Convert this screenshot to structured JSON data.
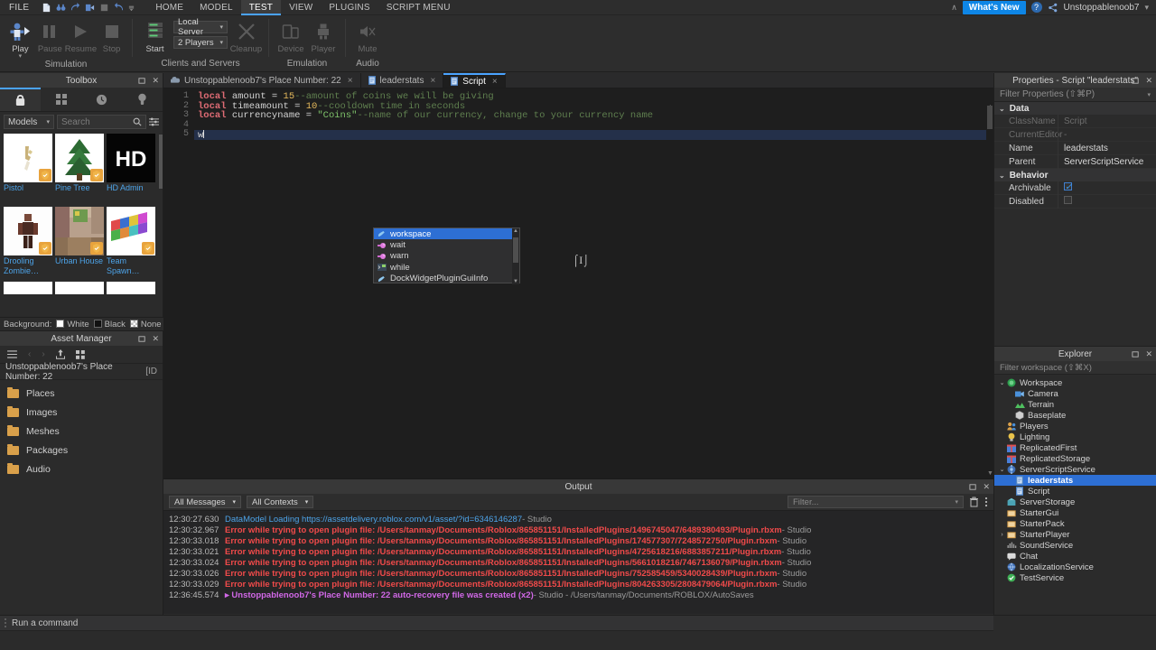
{
  "menubar": {
    "file_label": "FILE",
    "quick_icons": [
      "new-file-icon",
      "binoculars-icon",
      "redo-icon",
      "publish-icon",
      "stop-icon",
      "undo-icon",
      "overflow-icon"
    ],
    "tabs": [
      {
        "label": "HOME",
        "active": false
      },
      {
        "label": "MODEL",
        "active": false
      },
      {
        "label": "TEST",
        "active": true
      },
      {
        "label": "VIEW",
        "active": false
      },
      {
        "label": "PLUGINS",
        "active": false
      },
      {
        "label": "SCRIPT MENU",
        "active": false
      }
    ],
    "whats_new": "What's New",
    "help_icon": "?",
    "share_icon": "share-icon",
    "user": "Unstoppablenoob7",
    "user_caret": "▾",
    "collapse_caret": "∧",
    "accent_color": "#0e86e6"
  },
  "ribbon": {
    "groups": [
      {
        "label": "Simulation",
        "buttons": [
          {
            "label": "Play",
            "icon": "play-avatar-icon",
            "enabled": true,
            "has_caret": true
          },
          {
            "label": "Pause",
            "icon": "pause-icon",
            "enabled": false
          },
          {
            "label": "Resume",
            "icon": "resume-icon",
            "enabled": false
          },
          {
            "label": "Stop",
            "icon": "stop-icon",
            "enabled": false
          }
        ]
      },
      {
        "label": "Clients and Servers",
        "buttons": [
          {
            "label": "Start",
            "icon": "server-rack-icon",
            "enabled": true
          },
          {
            "label": "Cleanup",
            "icon": "cleanup-x-icon",
            "enabled": false
          }
        ],
        "combos": [
          {
            "value": "Local Server",
            "caret": "▾"
          },
          {
            "value": "2 Players",
            "caret": "▾"
          }
        ]
      },
      {
        "label": "Emulation",
        "buttons": [
          {
            "label": "Device",
            "icon": "device-icon",
            "enabled": false
          },
          {
            "label": "Player",
            "icon": "player-icon",
            "enabled": false
          }
        ]
      },
      {
        "label": "Audio",
        "buttons": [
          {
            "label": "Mute",
            "icon": "mute-speaker-icon",
            "enabled": false
          }
        ]
      }
    ]
  },
  "toolbox": {
    "title": "Toolbox",
    "tabs": [
      {
        "icon": "backpack-icon",
        "active": true
      },
      {
        "icon": "grid-icon",
        "active": false
      },
      {
        "icon": "clock-icon",
        "active": false
      },
      {
        "icon": "bulb-icon",
        "active": false
      }
    ],
    "category": "Models",
    "category_caret": "▾",
    "search_placeholder": "Search",
    "search_icon": "search-icon",
    "filter_icon": "filter-sliders-icon",
    "items": [
      {
        "name": "Pistol",
        "thumb": "pistol"
      },
      {
        "name": "Pine Tree",
        "thumb": "pinetree"
      },
      {
        "name": "HD Admin",
        "thumb": "hdadmin"
      },
      {
        "name": "Drooling Zombie…",
        "thumb": "zombie"
      },
      {
        "name": "Urban House",
        "thumb": "house"
      },
      {
        "name": "Team Spawn…",
        "thumb": "spawn"
      }
    ],
    "background_label": "Background:",
    "background_options": [
      {
        "label": "White",
        "selected": true
      },
      {
        "label": "Black",
        "selected": false
      },
      {
        "label": "None",
        "selected": false
      }
    ]
  },
  "asset_manager": {
    "title": "Asset Manager",
    "toolbar_icons": [
      "hamburger-icon",
      "back-arrow-icon",
      "forward-arrow-icon",
      "upload-icon",
      "grid-view-icon"
    ],
    "path": "Unstoppablenoob7's Place Number: 22",
    "path_suffix": "[ID",
    "folders": [
      "Places",
      "Images",
      "Meshes",
      "Packages",
      "Audio"
    ]
  },
  "editor": {
    "tabs": [
      {
        "label": "Unstoppablenoob7's Place Number: 22",
        "icon": "place-icon",
        "active": false
      },
      {
        "label": "leaderstats",
        "icon": "script-icon",
        "active": false
      },
      {
        "label": "Script",
        "icon": "script-icon",
        "active": true
      }
    ],
    "close_glyph": "×",
    "line_numbers": [
      "1",
      "2",
      "3",
      "4",
      "5"
    ],
    "lines": [
      [
        {
          "t": "local",
          "c": "kw"
        },
        {
          "t": " amount = ",
          "c": "id"
        },
        {
          "t": "15",
          "c": "num"
        },
        {
          "t": "--amount of coins we will be giving",
          "c": "cmt"
        }
      ],
      [
        {
          "t": "local",
          "c": "kw"
        },
        {
          "t": " timeamount = ",
          "c": "id"
        },
        {
          "t": "10",
          "c": "num"
        },
        {
          "t": "--cooldown time in seconds",
          "c": "cmt"
        }
      ],
      [
        {
          "t": "local",
          "c": "kw"
        },
        {
          "t": " currencyname = ",
          "c": "id"
        },
        {
          "t": "\"Coins\"",
          "c": "str"
        },
        {
          "t": "--name of our currency, change to your currency name",
          "c": "cmt"
        }
      ],
      [],
      [
        {
          "t": "w",
          "c": "id"
        }
      ]
    ],
    "autocomplete": {
      "items": [
        {
          "label": "workspace",
          "icon": "object-icon",
          "selected": true
        },
        {
          "label": "wait",
          "icon": "function-icon",
          "selected": false
        },
        {
          "label": "warn",
          "icon": "function-icon",
          "selected": false
        },
        {
          "label": "while",
          "icon": "snippet-icon",
          "selected": false
        },
        {
          "label": "DockWidgetPluginGuiInfo",
          "icon": "object-icon",
          "selected": false
        }
      ],
      "scroll_up": "▲",
      "scroll_down": "▼"
    }
  },
  "output": {
    "title": "Output",
    "filters": [
      {
        "value": "All Messages",
        "caret": "▾"
      },
      {
        "value": "All Contexts",
        "caret": "▾"
      }
    ],
    "filter_placeholder": "Filter...",
    "filter_caret": "▾",
    "trash_icon": "trash-icon",
    "menu_icon": "kebab-menu-icon",
    "lines": [
      {
        "time": "12:30:27.630",
        "text": "DataModel Loading https://assetdelivery.roblox.com/v1/asset/?id=6346146287",
        "source": " -  Studio",
        "level": "info"
      },
      {
        "time": "12:30:32.967",
        "text": "Error while trying to open plugin file: /Users/tanmay/Documents/Roblox/865851151/InstalledPlugins/1496745047/6489380493/Plugin.rbxm",
        "source": " -  Studio",
        "level": "error"
      },
      {
        "time": "12:30:33.018",
        "text": "Error while trying to open plugin file: /Users/tanmay/Documents/Roblox/865851151/InstalledPlugins/174577307/7248572750/Plugin.rbxm",
        "source": " -  Studio",
        "level": "error"
      },
      {
        "time": "12:30:33.021",
        "text": "Error while trying to open plugin file: /Users/tanmay/Documents/Roblox/865851151/InstalledPlugins/4725618216/6883857211/Plugin.rbxm",
        "source": " -  Studio",
        "level": "error"
      },
      {
        "time": "12:30:33.024",
        "text": "Error while trying to open plugin file: /Users/tanmay/Documents/Roblox/865851151/InstalledPlugins/5661018216/7467136079/Plugin.rbxm",
        "source": " -  Studio",
        "level": "error"
      },
      {
        "time": "12:30:33.026",
        "text": "Error while trying to open plugin file: /Users/tanmay/Documents/Roblox/865851151/InstalledPlugins/752585459/5340028439/Plugin.rbxm",
        "source": " -  Studio",
        "level": "error"
      },
      {
        "time": "12:30:33.029",
        "text": "Error while trying to open plugin file: /Users/tanmay/Documents/Roblox/865851151/InstalledPlugins/804263305/2808479064/Plugin.rbxm",
        "source": " -  Studio",
        "level": "error"
      },
      {
        "time": "12:36:45.574",
        "text": "▸ Unstoppablenoob7's Place Number: 22 auto-recovery file was created (x2)",
        "source": " -  Studio - /Users/tanmay/Documents/ROBLOX/AutoSaves",
        "level": "warn"
      }
    ]
  },
  "properties": {
    "title": "Properties - Script \"leaderstats\"",
    "filter_placeholder": "Filter Properties (⇧⌘P)",
    "filter_caret": "▾",
    "sections": [
      {
        "name": "Data",
        "caret": "⌄",
        "rows": [
          {
            "key": "ClassName",
            "value": "Script",
            "disabled": true,
            "type": "text"
          },
          {
            "key": "CurrentEditor",
            "value": "-",
            "disabled": true,
            "type": "text"
          },
          {
            "key": "Name",
            "value": "leaderstats",
            "disabled": false,
            "type": "text"
          },
          {
            "key": "Parent",
            "value": "ServerScriptService",
            "disabled": false,
            "type": "text"
          }
        ]
      },
      {
        "name": "Behavior",
        "caret": "⌄",
        "rows": [
          {
            "key": "Archivable",
            "value": "",
            "checked": true,
            "disabled": false,
            "type": "checkbox"
          },
          {
            "key": "Disabled",
            "value": "",
            "checked": false,
            "disabled": false,
            "type": "checkbox"
          }
        ]
      }
    ]
  },
  "explorer": {
    "title": "Explorer",
    "filter_placeholder": "Filter workspace (⇧⌘X)",
    "nodes": [
      {
        "label": "Workspace",
        "depth": 0,
        "arrow": "⌄",
        "icon": "workspace-icon",
        "color": "#4caf50",
        "selected": false
      },
      {
        "label": "Camera",
        "depth": 2,
        "arrow": "",
        "icon": "camera-icon",
        "color": "#4a90d9",
        "selected": false
      },
      {
        "label": "Terrain",
        "depth": 2,
        "arrow": "",
        "icon": "terrain-icon",
        "color": "#5fbf5f",
        "selected": false
      },
      {
        "label": "Baseplate",
        "depth": 2,
        "arrow": "",
        "icon": "part-icon",
        "color": "#bdbdbd",
        "selected": false
      },
      {
        "label": "Players",
        "depth": 1,
        "arrow": "",
        "icon": "players-icon",
        "color": "#d9a04a",
        "selected": false
      },
      {
        "label": "Lighting",
        "depth": 1,
        "arrow": "",
        "icon": "lighting-icon",
        "color": "#e8c24a",
        "selected": false
      },
      {
        "label": "ReplicatedFirst",
        "depth": 1,
        "arrow": "",
        "icon": "replicated-icon",
        "color": "#e05050",
        "selected": false
      },
      {
        "label": "ReplicatedStorage",
        "depth": 1,
        "arrow": "",
        "icon": "replicated-icon",
        "color": "#e05050",
        "selected": false
      },
      {
        "label": "ServerScriptService",
        "depth": 1,
        "arrow": "⌄",
        "icon": "service-icon",
        "color": "#4a7fd9",
        "selected": false
      },
      {
        "label": "leaderstats",
        "depth": 2,
        "arrow": "",
        "icon": "script-icon",
        "color": "#7fb5e8",
        "selected": true
      },
      {
        "label": "Script",
        "depth": 2,
        "arrow": "",
        "icon": "script-icon",
        "color": "#7fb5e8",
        "selected": false
      },
      {
        "label": "ServerStorage",
        "depth": 1,
        "arrow": "",
        "icon": "storage-icon",
        "color": "#4aa3b5",
        "selected": false
      },
      {
        "label": "StarterGui",
        "depth": 1,
        "arrow": "",
        "icon": "starter-icon",
        "color": "#d9a04a",
        "selected": false
      },
      {
        "label": "StarterPack",
        "depth": 1,
        "arrow": "",
        "icon": "starter-icon",
        "color": "#d9a04a",
        "selected": false
      },
      {
        "label": "StarterPlayer",
        "depth": 1,
        "arrow": "›",
        "icon": "starter-icon",
        "color": "#d9a04a",
        "selected": false
      },
      {
        "label": "SoundService",
        "depth": 1,
        "arrow": "",
        "icon": "sound-icon",
        "color": "#9a9a9a",
        "selected": false
      },
      {
        "label": "Chat",
        "depth": 1,
        "arrow": "",
        "icon": "chat-icon",
        "color": "#dcdcdc",
        "selected": false
      },
      {
        "label": "LocalizationService",
        "depth": 1,
        "arrow": "",
        "icon": "localization-icon",
        "color": "#4a7fd9",
        "selected": false
      },
      {
        "label": "TestService",
        "depth": 1,
        "arrow": "",
        "icon": "test-icon",
        "color": "#4caf50",
        "selected": false
      }
    ]
  },
  "statusbar": {
    "command_placeholder": "Run a command",
    "grip_icon": "grip-dots-icon"
  }
}
